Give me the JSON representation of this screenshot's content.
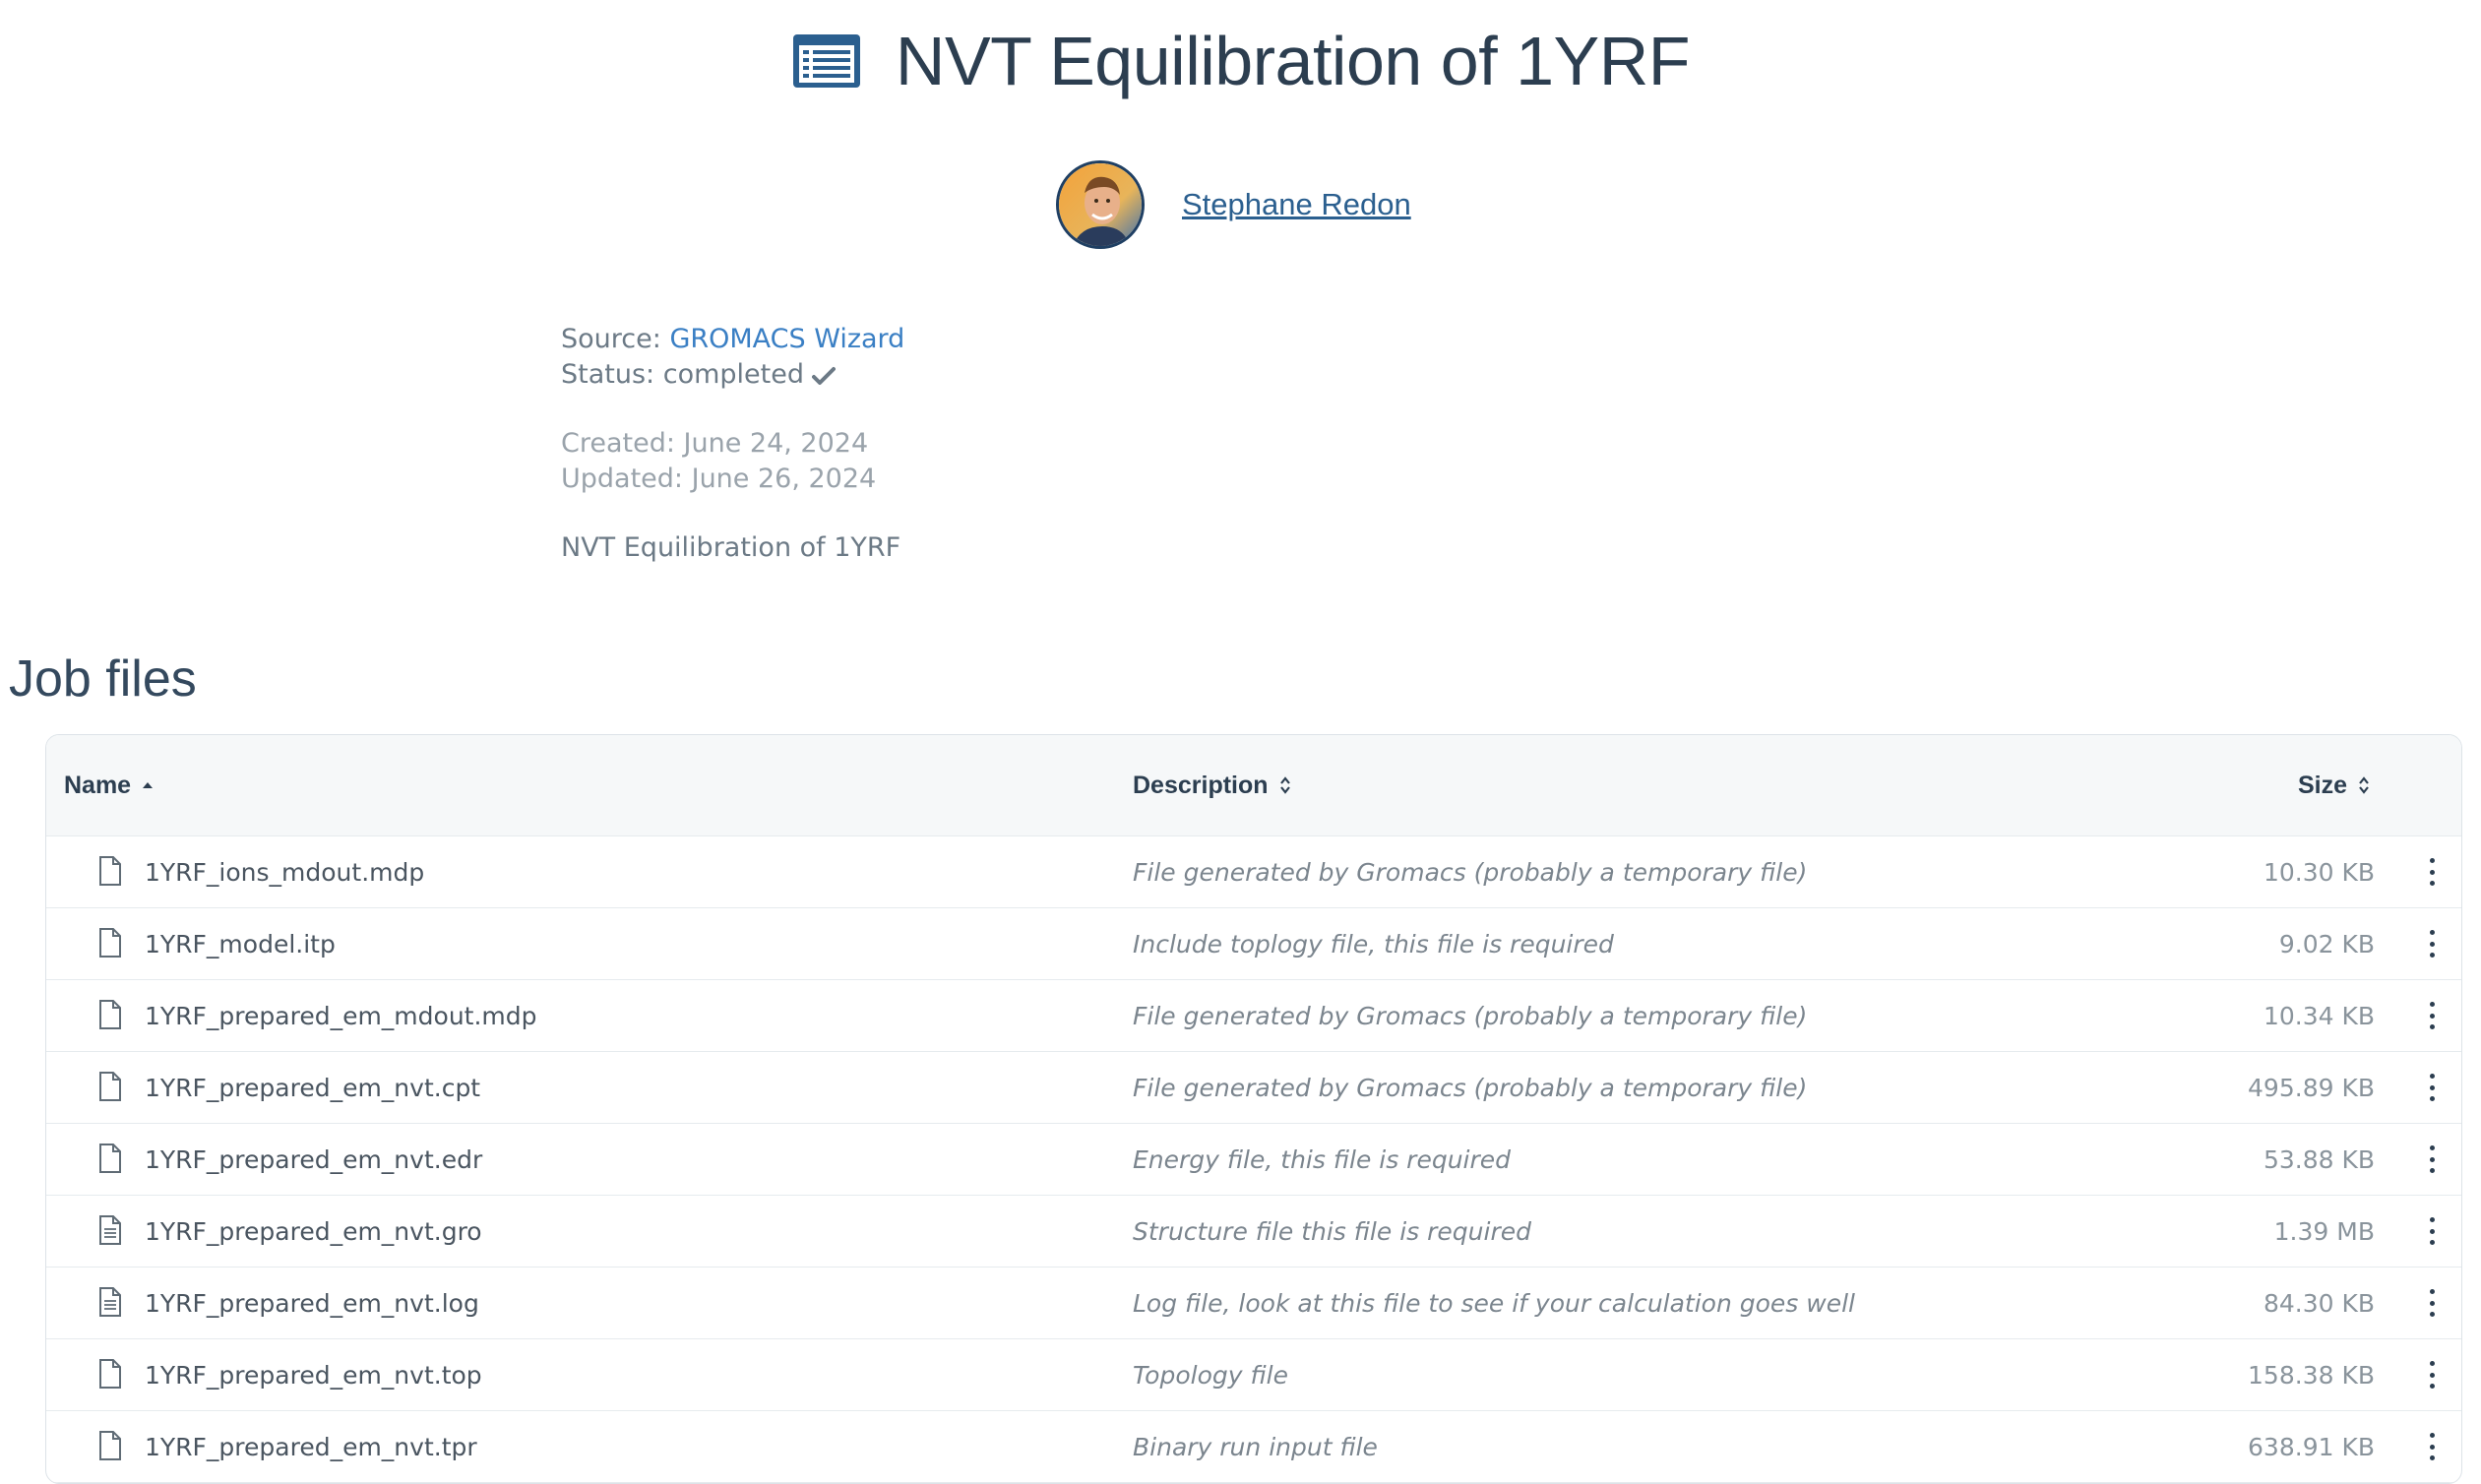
{
  "page": {
    "title": "NVT Equilibration of 1YRF",
    "title_icon": "list-alt-icon",
    "accent_color": "#2b5f8f"
  },
  "author": {
    "name": "Stephane Redon"
  },
  "meta": {
    "source_label": "Source:",
    "source_value": "GROMACS Wizard",
    "status_label": "Status:",
    "status_value": "completed",
    "status_icon": "check-icon",
    "created": "Created: June 24, 2024",
    "updated": "Updated: June 26, 2024",
    "description": "NVT Equilibration of 1YRF"
  },
  "files": {
    "section_title": "Job files",
    "columns": {
      "name": "Name",
      "description": "Description",
      "size": "Size"
    },
    "rows": [
      {
        "name": "1YRF_ions_mdout.mdp",
        "description": "File generated by Gromacs (probably a temporary file)",
        "size": "10.30 KB",
        "icon": "file-icon"
      },
      {
        "name": "1YRF_model.itp",
        "description": "Include toplogy file, this file is required",
        "size": "9.02 KB",
        "icon": "file-icon"
      },
      {
        "name": "1YRF_prepared_em_mdout.mdp",
        "description": "File generated by Gromacs (probably a temporary file)",
        "size": "10.34 KB",
        "icon": "file-icon"
      },
      {
        "name": "1YRF_prepared_em_nvt.cpt",
        "description": "File generated by Gromacs (probably a temporary file)",
        "size": "495.89 KB",
        "icon": "file-icon"
      },
      {
        "name": "1YRF_prepared_em_nvt.edr",
        "description": "Energy file, this file is required",
        "size": "53.88 KB",
        "icon": "file-icon"
      },
      {
        "name": "1YRF_prepared_em_nvt.gro",
        "description": "Structure file this file is required",
        "size": "1.39 MB",
        "icon": "file-text-icon"
      },
      {
        "name": "1YRF_prepared_em_nvt.log",
        "description": "Log file, look at this file to see if your calculation goes well",
        "size": "84.30 KB",
        "icon": "file-text-icon"
      },
      {
        "name": "1YRF_prepared_em_nvt.top",
        "description": "Topology file",
        "size": "158.38 KB",
        "icon": "file-icon"
      },
      {
        "name": "1YRF_prepared_em_nvt.tpr",
        "description": "Binary run input file",
        "size": "638.91 KB",
        "icon": "file-icon"
      }
    ]
  }
}
